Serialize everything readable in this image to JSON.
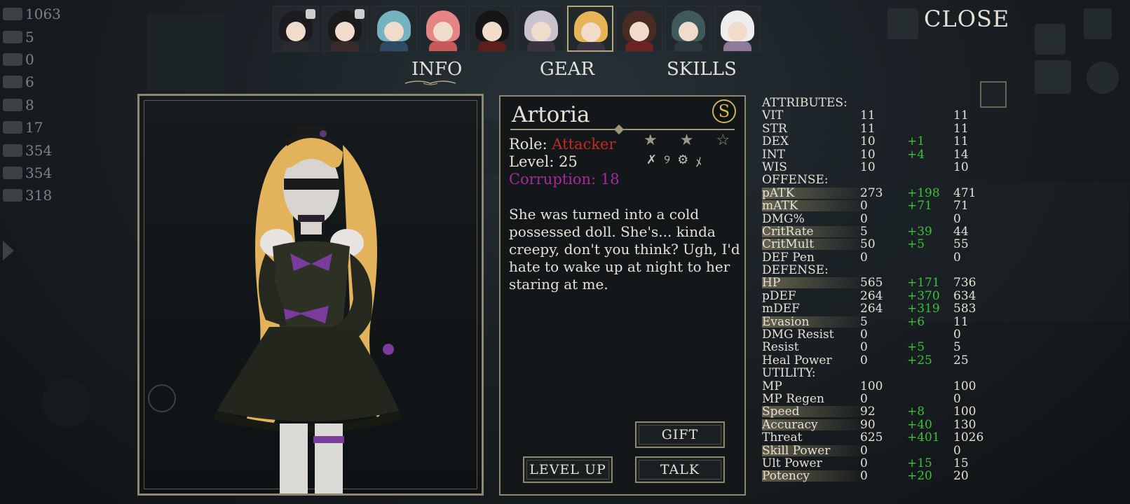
{
  "resources": [
    {
      "icon": "soldier-icon",
      "value": "1063"
    },
    {
      "icon": "spiral-icon",
      "value": "5"
    },
    {
      "icon": "swords-icon",
      "value": "0"
    },
    {
      "icon": "wood-icon",
      "value": "6"
    },
    {
      "icon": "log-icon",
      "value": "8"
    },
    {
      "icon": "ingot-icon",
      "value": "17"
    },
    {
      "icon": "ore-icon",
      "value": "354"
    },
    {
      "icon": "plank-icon",
      "value": "354"
    },
    {
      "icon": "stone-icon",
      "value": "318"
    }
  ],
  "portraits": [
    {
      "name": "hooded",
      "hair": "#1c1c20",
      "body": "#2a2a2e",
      "locked": true,
      "selected": false
    },
    {
      "name": "masked",
      "hair": "#1b1b1b",
      "body": "#3b2a2a",
      "locked": true,
      "selected": false
    },
    {
      "name": "teal",
      "hair": "#76b3c0",
      "body": "#2f4b63",
      "locked": false,
      "selected": false
    },
    {
      "name": "pink",
      "hair": "#e58585",
      "body": "#c65a5a",
      "locked": false,
      "selected": false
    },
    {
      "name": "dark",
      "hair": "#151518",
      "body": "#5f1e1e",
      "locked": false,
      "selected": false
    },
    {
      "name": "silver",
      "hair": "#c8c3cc",
      "body": "#3a3340",
      "locked": false,
      "selected": false
    },
    {
      "name": "artoria",
      "hair": "#e6b456",
      "body": "#3a3342",
      "locked": false,
      "selected": true
    },
    {
      "name": "hat",
      "hair": "#4a2a22",
      "body": "#6e2222",
      "locked": false,
      "selected": false
    },
    {
      "name": "gray",
      "hair": "#3f5a5d",
      "body": "#2d3a3d",
      "locked": false,
      "selected": false
    },
    {
      "name": "white",
      "hair": "#eeeeee",
      "body": "#8f7a9a",
      "locked": false,
      "selected": false
    }
  ],
  "close_label": "CLOSE",
  "tabs": {
    "info": "INFO",
    "gear": "GEAR",
    "skills": "SKILLS"
  },
  "character": {
    "name": "Artoria",
    "rank": "S",
    "role_label": "Role:",
    "role_value": "Attacker",
    "level": "Level: 25",
    "corruption": "Corruption: 18",
    "description": "She was turned into a cold possessed doll. She's... kinda creepy, don't you think? Ugh, I'd hate to wake up at night to her staring at me.",
    "stars": [
      "★",
      "★",
      "☆"
    ],
    "class_icons": [
      "✗",
      "୨",
      "⚙",
      "ﾒ"
    ]
  },
  "buttons": {
    "gift": "GIFT",
    "level_up": "LEVEL UP",
    "talk": "TALK"
  },
  "stats": {
    "attributes_header": "ATTRIBUTES:",
    "attributes": [
      {
        "name": "VIT",
        "base": "11",
        "bonus": "",
        "total": "11",
        "hl": false
      },
      {
        "name": "STR",
        "base": "11",
        "bonus": "",
        "total": "11",
        "hl": false
      },
      {
        "name": "DEX",
        "base": "10",
        "bonus": "+1",
        "total": "11",
        "hl": false
      },
      {
        "name": "INT",
        "base": "10",
        "bonus": "+4",
        "total": "14",
        "hl": false
      },
      {
        "name": "WIS",
        "base": "10",
        "bonus": "",
        "total": "10",
        "hl": false
      }
    ],
    "offense_header": "OFFENSE:",
    "offense": [
      {
        "name": "pATK",
        "base": "273",
        "bonus": "+198",
        "total": "471",
        "hl": true
      },
      {
        "name": "mATK",
        "base": "0",
        "bonus": "+71",
        "total": "71",
        "hl": true
      },
      {
        "name": "DMG%",
        "base": "0",
        "bonus": "",
        "total": "0",
        "hl": false
      },
      {
        "name": "CritRate",
        "base": "5",
        "bonus": "+39",
        "total": "44",
        "hl": true
      },
      {
        "name": "CritMult",
        "base": "50",
        "bonus": "+5",
        "total": "55",
        "hl": true
      },
      {
        "name": "DEF Pen",
        "base": "0",
        "bonus": "",
        "total": "0",
        "hl": false
      }
    ],
    "defense_header": "DEFENSE:",
    "defense": [
      {
        "name": "HP",
        "base": "565",
        "bonus": "+171",
        "total": "736",
        "hl": true
      },
      {
        "name": "pDEF",
        "base": "264",
        "bonus": "+370",
        "total": "634",
        "hl": false
      },
      {
        "name": "mDEF",
        "base": "264",
        "bonus": "+319",
        "total": "583",
        "hl": false
      },
      {
        "name": "Evasion",
        "base": "5",
        "bonus": "+6",
        "total": "11",
        "hl": true
      },
      {
        "name": "DMG Resist",
        "base": "0",
        "bonus": "",
        "total": "0",
        "hl": false
      },
      {
        "name": "Resist",
        "base": "0",
        "bonus": "+5",
        "total": "5",
        "hl": false
      },
      {
        "name": "Heal Power",
        "base": "0",
        "bonus": "+25",
        "total": "25",
        "hl": false
      }
    ],
    "utility_header": "UTILITY:",
    "utility": [
      {
        "name": "MP",
        "base": "100",
        "bonus": "",
        "total": "100",
        "hl": false
      },
      {
        "name": "MP Regen",
        "base": "0",
        "bonus": "",
        "total": "0",
        "hl": false
      },
      {
        "name": "Speed",
        "base": "92",
        "bonus": "+8",
        "total": "100",
        "hl": true
      },
      {
        "name": "Accuracy",
        "base": "90",
        "bonus": "+40",
        "total": "130",
        "hl": true
      },
      {
        "name": "Threat",
        "base": "625",
        "bonus": "+401",
        "total": "1026",
        "hl": false
      },
      {
        "name": "Skill Power",
        "base": "0",
        "bonus": "",
        "total": "0",
        "hl": true
      },
      {
        "name": "Ult Power",
        "base": "0",
        "bonus": "+15",
        "total": "15",
        "hl": false
      },
      {
        "name": "Potency",
        "base": "0",
        "bonus": "+20",
        "total": "20",
        "hl": true
      }
    ]
  }
}
